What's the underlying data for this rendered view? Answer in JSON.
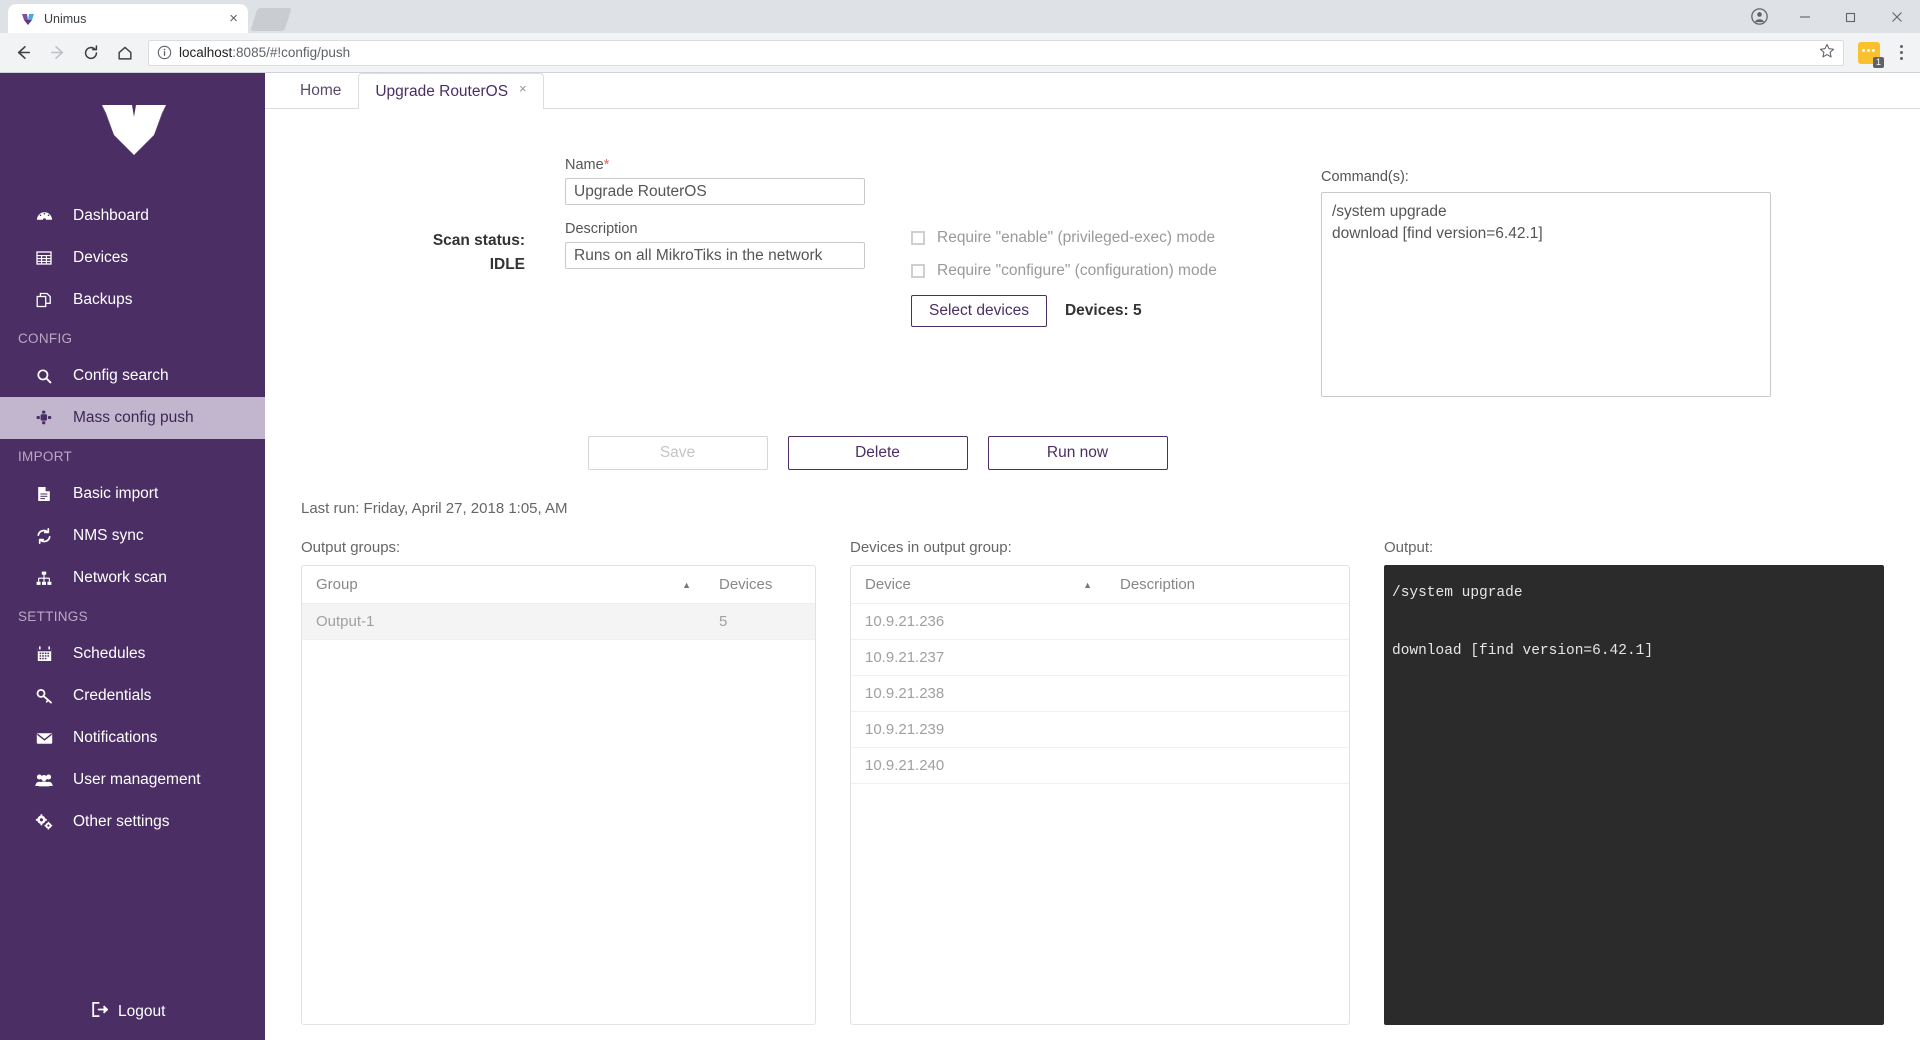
{
  "browser": {
    "tab_title": "Unimus",
    "tab_favicon": "unimus-logo-icon",
    "tab_close": "×",
    "url_scheme_host": "localhost",
    "url_rest": ":8085/#!config/push",
    "new_tab_name": "new-tab",
    "account_icon": "account-icon",
    "minimize": "minimize-icon",
    "maximize": "maximize-icon",
    "close": "close-icon",
    "back": "back-arrow-icon",
    "forward": "forward-arrow-icon",
    "reload": "reload-icon",
    "home": "home-icon",
    "info": "info-circle-icon",
    "star": "star-icon",
    "extension_badge_count": "1",
    "menu": "kebab-menu-icon"
  },
  "sidebar": {
    "logo_name": "unimus-logo",
    "items": [
      {
        "label": "Dashboard",
        "icon": "dashboard-icon",
        "active": false
      },
      {
        "label": "Devices",
        "icon": "grid-icon",
        "active": false
      },
      {
        "label": "Backups",
        "icon": "copy-icon",
        "active": false
      }
    ],
    "sections": [
      {
        "title": "CONFIG",
        "items": [
          {
            "label": "Config search",
            "icon": "search-icon",
            "active": false
          },
          {
            "label": "Mass config push",
            "icon": "puzzle-icon",
            "active": true
          }
        ]
      },
      {
        "title": "IMPORT",
        "items": [
          {
            "label": "Basic import",
            "icon": "document-icon",
            "active": false
          },
          {
            "label": "NMS sync",
            "icon": "sync-icon",
            "active": false
          },
          {
            "label": "Network scan",
            "icon": "sitemap-icon",
            "active": false
          }
        ]
      },
      {
        "title": "SETTINGS",
        "items": [
          {
            "label": "Schedules",
            "icon": "calendar-icon",
            "active": false
          },
          {
            "label": "Credentials",
            "icon": "key-icon",
            "active": false
          },
          {
            "label": "Notifications",
            "icon": "envelope-icon",
            "active": false
          },
          {
            "label": "User management",
            "icon": "users-icon",
            "active": false
          },
          {
            "label": "Other settings",
            "icon": "gears-icon",
            "active": false
          }
        ]
      }
    ],
    "logout_label": "Logout",
    "logout_icon": "logout-icon",
    "bg_color": "#4b2e63",
    "active_bg_color": "#c2b6cf"
  },
  "content_tabs": [
    {
      "label": "Home",
      "active": false,
      "closable": false
    },
    {
      "label": "Upgrade RouterOS",
      "active": true,
      "closable": true,
      "close_glyph": "×"
    }
  ],
  "form": {
    "scan_status_label": "Scan status:",
    "scan_status_value": "IDLE",
    "name_label": "Name",
    "name_required_mark": "*",
    "name_value": "Upgrade RouterOS",
    "description_label": "Description",
    "description_value": "Runs on all MikroTiks in the network",
    "checkbox_enable_label": "Require \"enable\" (privileged-exec) mode",
    "checkbox_enable_checked": false,
    "checkbox_configure_label": "Require \"configure\" (configuration) mode",
    "checkbox_configure_checked": false,
    "select_devices_label": "Select devices",
    "devices_count_label": "Devices: 5",
    "commands_label": "Command(s):",
    "commands_value": "/system upgrade\ndownload [find version=6.42.1]"
  },
  "actions": {
    "save_label": "Save",
    "save_disabled": true,
    "delete_label": "Delete",
    "run_now_label": "Run now"
  },
  "last_run": "Last run: Friday, April 27, 2018 1:05, AM",
  "output_groups": {
    "title": "Output groups:",
    "columns": [
      "Group",
      "Devices"
    ],
    "sort_column": "Group",
    "sort_dir": "asc",
    "rows": [
      {
        "group": "Output-1",
        "devices": "5",
        "selected": true
      }
    ]
  },
  "devices_in_group": {
    "title": "Devices in output group:",
    "columns": [
      "Device",
      "Description"
    ],
    "sort_column": "Device",
    "sort_dir": "asc",
    "rows": [
      {
        "device": "10.9.21.236",
        "description": ""
      },
      {
        "device": "10.9.21.237",
        "description": ""
      },
      {
        "device": "10.9.21.238",
        "description": ""
      },
      {
        "device": "10.9.21.239",
        "description": ""
      },
      {
        "device": "10.9.21.240",
        "description": ""
      }
    ]
  },
  "output": {
    "title": "Output:",
    "text": "/system upgrade\n\ndownload [find version=6.42.1]",
    "bg_color": "#2b2b2b",
    "fg_color": "#e6e6e6"
  }
}
